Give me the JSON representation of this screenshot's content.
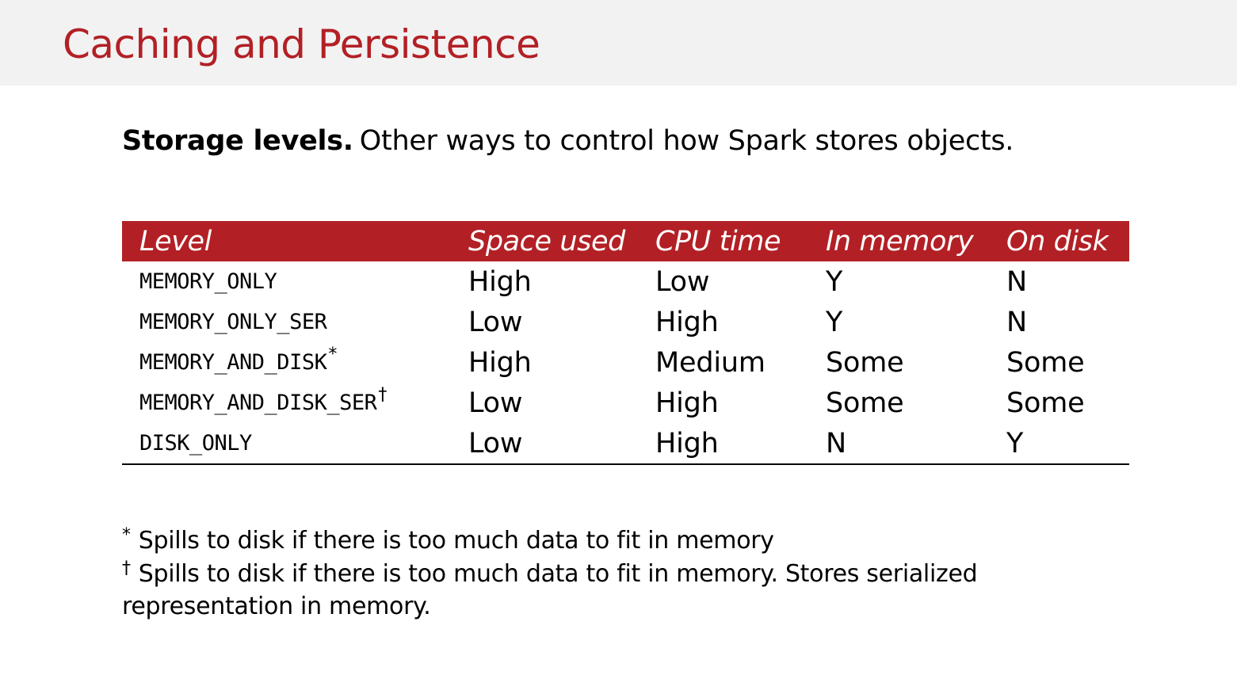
{
  "slide": {
    "title": "Caching and Persistence"
  },
  "intro": {
    "bold": "Storage levels.",
    "text": "Other ways to control how Spark stores objects."
  },
  "table": {
    "headers": [
      "Level",
      "Space used",
      "CPU time",
      "In memory",
      "On disk"
    ],
    "rows": [
      {
        "level": "MEMORY_ONLY",
        "mark": "",
        "space": "High",
        "cpu": "Low",
        "memory": "Y",
        "disk": "N"
      },
      {
        "level": "MEMORY_ONLY_SER",
        "mark": "",
        "space": "Low",
        "cpu": "High",
        "memory": "Y",
        "disk": "N"
      },
      {
        "level": "MEMORY_AND_DISK",
        "mark": "*",
        "space": "High",
        "cpu": "Medium",
        "memory": "Some",
        "disk": "Some"
      },
      {
        "level": "MEMORY_AND_DISK_SER",
        "mark": "†",
        "space": "Low",
        "cpu": "High",
        "memory": "Some",
        "disk": "Some"
      },
      {
        "level": "DISK_ONLY",
        "mark": "",
        "space": "Low",
        "cpu": "High",
        "memory": "N",
        "disk": "Y"
      }
    ]
  },
  "footnotes": {
    "star_mark": "*",
    "star_text": "Spills to disk if there is too much data to fit in memory",
    "dagger_mark": "†",
    "dagger_text_line1": "Spills to disk if there is too much data to fit in memory. Stores serialized",
    "dagger_text_line2": "representation in memory."
  },
  "colors": {
    "accent": "#b22025",
    "title_bar_bg": "#f2f2f2"
  }
}
